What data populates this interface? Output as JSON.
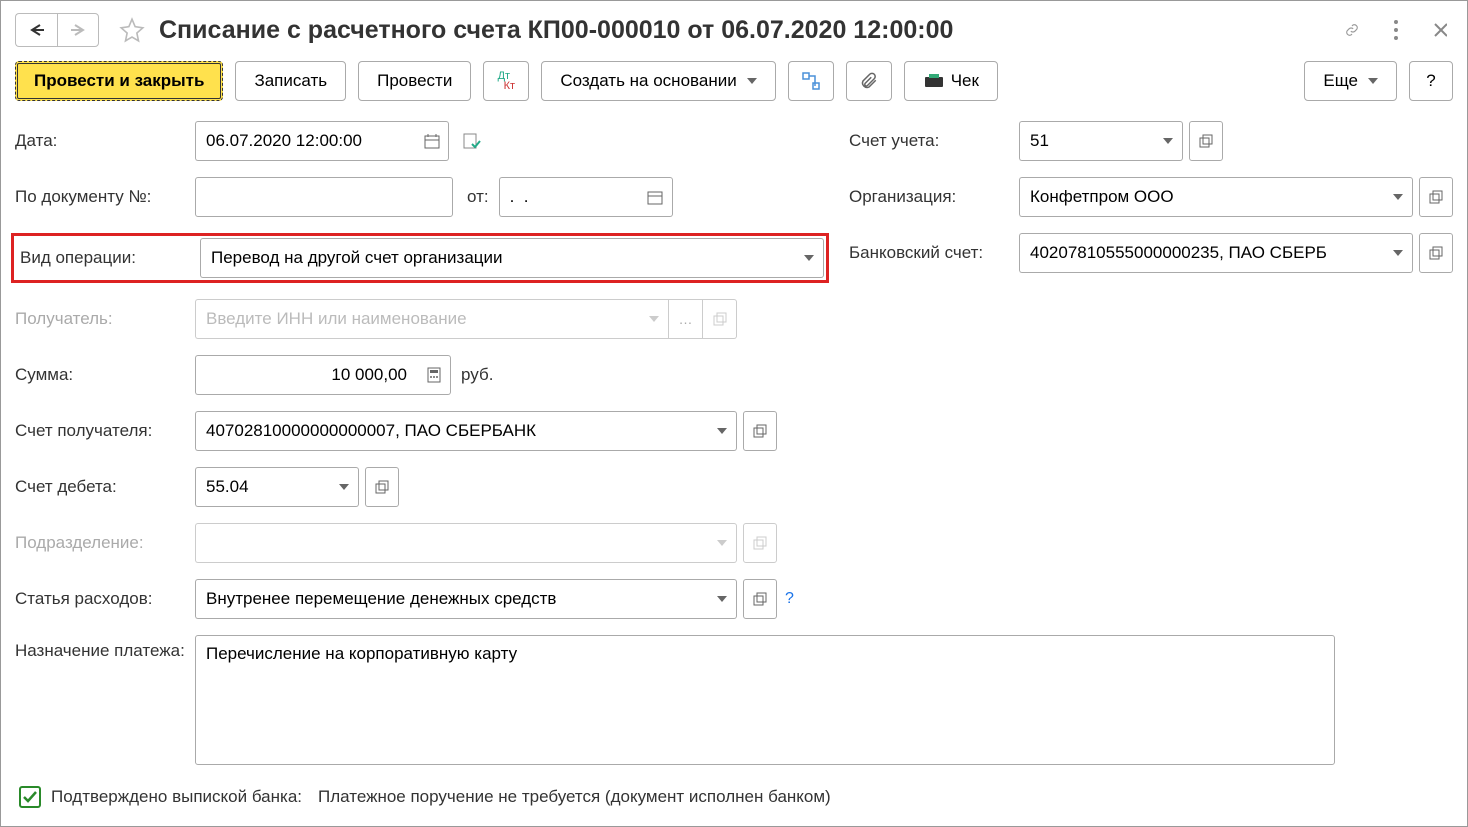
{
  "header": {
    "title": "Списание с расчетного счета КП00-000010 от 06.07.2020 12:00:00"
  },
  "toolbar": {
    "post_close": "Провести и закрыть",
    "save": "Записать",
    "post": "Провести",
    "create_based": "Создать на основании",
    "cheque": "Чек",
    "more": "Еще",
    "help": "?"
  },
  "labels": {
    "date": "Дата:",
    "doc_no": "По документу №:",
    "doc_from": "от:",
    "op_type": "Вид операции:",
    "recipient": "Получатель:",
    "amount": "Сумма:",
    "currency": "руб.",
    "recipient_account": "Счет получателя:",
    "debit_account": "Счет дебета:",
    "department": "Подразделение:",
    "expense_item": "Статья расходов:",
    "purpose": "Назначение платежа:",
    "account": "Счет учета:",
    "organization": "Организация:",
    "bank_account": "Банковский счет:"
  },
  "values": {
    "date": "06.07.2020 12:00:00",
    "doc_no": "",
    "doc_from": ".  .",
    "op_type": "Перевод на другой счет организации",
    "recipient_placeholder": "Введите ИНН или наименование",
    "amount": "10 000,00",
    "recipient_account": "40702810000000000007, ПАО СБЕРБАНК",
    "debit_account": "55.04",
    "department": "",
    "expense_item": "Внутренее перемещение денежных средств",
    "purpose": "Перечисление на корпоративную карту",
    "account": "51",
    "organization": "Конфетпром ООО",
    "bank_account": "40207810555000000235, ПАО СБЕРБ"
  },
  "footer": {
    "confirmed_label": "Подтверждено выпиской банка:",
    "confirmed_text": "Платежное поручение не требуется (документ исполнен банком)"
  }
}
